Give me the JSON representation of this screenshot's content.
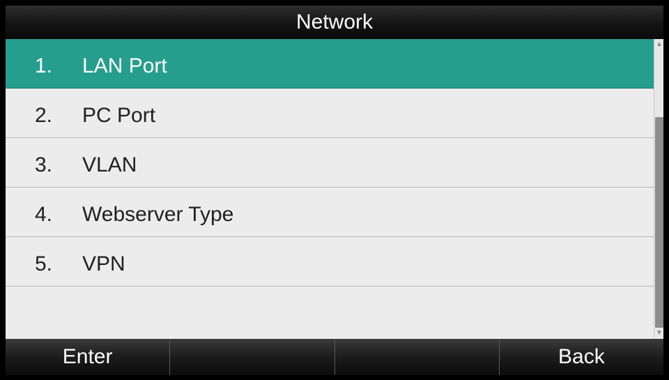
{
  "title": "Network",
  "menu": [
    {
      "num": "1.",
      "label": "LAN Port",
      "selected": true
    },
    {
      "num": "2.",
      "label": "PC Port",
      "selected": false
    },
    {
      "num": "3.",
      "label": "VLAN",
      "selected": false
    },
    {
      "num": "4.",
      "label": "Webserver Type",
      "selected": false
    },
    {
      "num": "5.",
      "label": "VPN",
      "selected": false
    }
  ],
  "scrollbar": {
    "thumb_start": 0.24,
    "thumb_end": 1.0
  },
  "softkeys": [
    "Enter",
    "",
    "",
    "Back"
  ],
  "colors": {
    "selected_bg": "#259e8d",
    "list_bg": "#ececec"
  }
}
